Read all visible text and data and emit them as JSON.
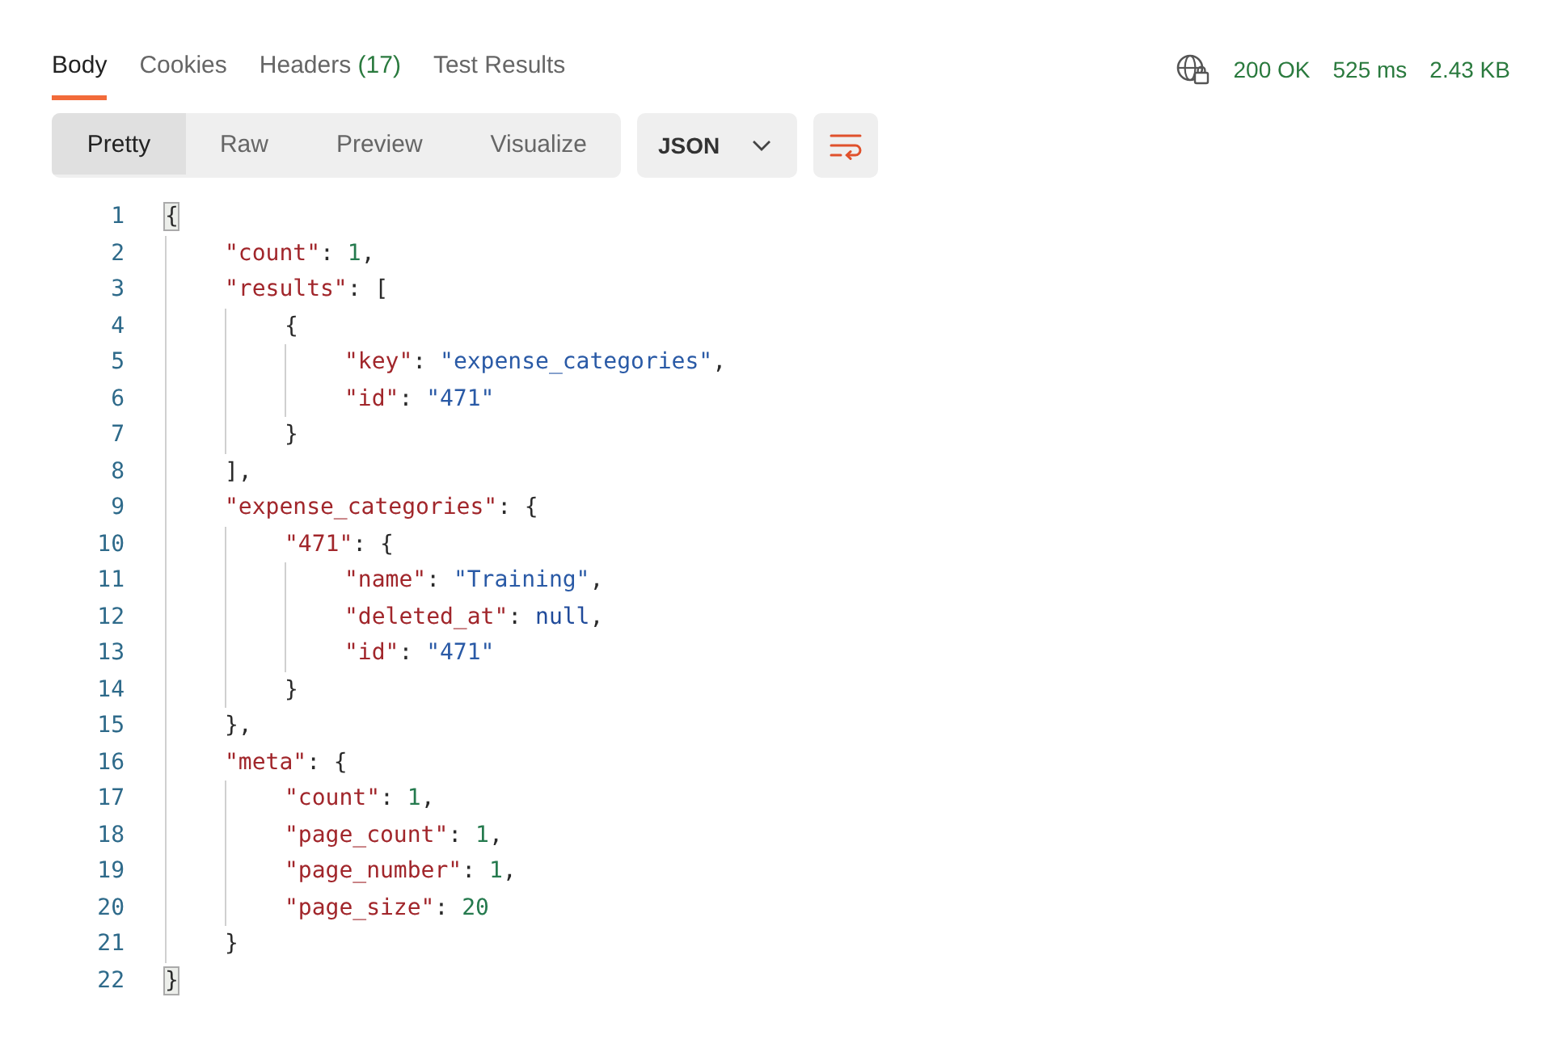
{
  "tabs": [
    {
      "label": "Body",
      "selected": true
    },
    {
      "label": "Cookies",
      "selected": false
    },
    {
      "label": "Headers",
      "count": "(17)",
      "selected": false
    },
    {
      "label": "Test Results",
      "selected": false
    }
  ],
  "status": {
    "code": "200 OK",
    "time": "525 ms",
    "size": "2.43 KB"
  },
  "view_modes": [
    {
      "label": "Pretty",
      "selected": true
    },
    {
      "label": "Raw",
      "selected": false
    },
    {
      "label": "Preview",
      "selected": false
    },
    {
      "label": "Visualize",
      "selected": false
    }
  ],
  "format_dropdown": {
    "value": "JSON"
  },
  "code": [
    {
      "number": "1",
      "bracket_highlight": true,
      "tokens": [
        {
          "kind": "punct",
          "text": "{"
        }
      ],
      "children": [
        {
          "number": "2",
          "bracket_highlight": false,
          "tokens": [
            {
              "kind": "key",
              "text": "\"count\""
            },
            {
              "kind": "punct",
              "text": ": "
            },
            {
              "kind": "number",
              "text": "1"
            },
            {
              "kind": "punct",
              "text": ","
            }
          ]
        },
        {
          "number": "3",
          "bracket_highlight": false,
          "tokens": [
            {
              "kind": "key",
              "text": "\"results\""
            },
            {
              "kind": "punct",
              "text": ": ["
            }
          ],
          "children": [
            {
              "number": "4",
              "bracket_highlight": false,
              "tokens": [
                {
                  "kind": "punct",
                  "text": "{"
                }
              ],
              "children": [
                {
                  "number": "5",
                  "bracket_highlight": false,
                  "tokens": [
                    {
                      "kind": "key",
                      "text": "\"key\""
                    },
                    {
                      "kind": "punct",
                      "text": ": "
                    },
                    {
                      "kind": "string",
                      "text": "\"expense_categories\""
                    },
                    {
                      "kind": "punct",
                      "text": ","
                    }
                  ]
                },
                {
                  "number": "6",
                  "bracket_highlight": false,
                  "tokens": [
                    {
                      "kind": "key",
                      "text": "\"id\""
                    },
                    {
                      "kind": "punct",
                      "text": ": "
                    },
                    {
                      "kind": "string",
                      "text": "\"471\""
                    }
                  ]
                }
              ]
            },
            {
              "number": "7",
              "bracket_highlight": false,
              "tokens": [
                {
                  "kind": "punct",
                  "text": "}"
                }
              ]
            }
          ]
        },
        {
          "number": "8",
          "bracket_highlight": false,
          "tokens": [
            {
              "kind": "punct",
              "text": "],"
            }
          ]
        },
        {
          "number": "9",
          "bracket_highlight": false,
          "tokens": [
            {
              "kind": "key",
              "text": "\"expense_categories\""
            },
            {
              "kind": "punct",
              "text": ": {"
            }
          ],
          "children": [
            {
              "number": "10",
              "bracket_highlight": false,
              "tokens": [
                {
                  "kind": "key",
                  "text": "\"471\""
                },
                {
                  "kind": "punct",
                  "text": ": {"
                }
              ],
              "children": [
                {
                  "number": "11",
                  "bracket_highlight": false,
                  "tokens": [
                    {
                      "kind": "key",
                      "text": "\"name\""
                    },
                    {
                      "kind": "punct",
                      "text": ": "
                    },
                    {
                      "kind": "string",
                      "text": "\"Training\""
                    },
                    {
                      "kind": "punct",
                      "text": ","
                    }
                  ]
                },
                {
                  "number": "12",
                  "bracket_highlight": false,
                  "tokens": [
                    {
                      "kind": "key",
                      "text": "\"deleted_at\""
                    },
                    {
                      "kind": "punct",
                      "text": ": "
                    },
                    {
                      "kind": "null",
                      "text": "null"
                    },
                    {
                      "kind": "punct",
                      "text": ","
                    }
                  ]
                },
                {
                  "number": "13",
                  "bracket_highlight": false,
                  "tokens": [
                    {
                      "kind": "key",
                      "text": "\"id\""
                    },
                    {
                      "kind": "punct",
                      "text": ": "
                    },
                    {
                      "kind": "string",
                      "text": "\"471\""
                    }
                  ]
                }
              ]
            },
            {
              "number": "14",
              "bracket_highlight": false,
              "tokens": [
                {
                  "kind": "punct",
                  "text": "}"
                }
              ]
            }
          ]
        },
        {
          "number": "15",
          "bracket_highlight": false,
          "tokens": [
            {
              "kind": "punct",
              "text": "},"
            }
          ]
        },
        {
          "number": "16",
          "bracket_highlight": false,
          "tokens": [
            {
              "kind": "key",
              "text": "\"meta\""
            },
            {
              "kind": "punct",
              "text": ": {"
            }
          ],
          "children": [
            {
              "number": "17",
              "bracket_highlight": false,
              "tokens": [
                {
                  "kind": "key",
                  "text": "\"count\""
                },
                {
                  "kind": "punct",
                  "text": ": "
                },
                {
                  "kind": "number",
                  "text": "1"
                },
                {
                  "kind": "punct",
                  "text": ","
                }
              ]
            },
            {
              "number": "18",
              "bracket_highlight": false,
              "tokens": [
                {
                  "kind": "key",
                  "text": "\"page_count\""
                },
                {
                  "kind": "punct",
                  "text": ": "
                },
                {
                  "kind": "number",
                  "text": "1"
                },
                {
                  "kind": "punct",
                  "text": ","
                }
              ]
            },
            {
              "number": "19",
              "bracket_highlight": false,
              "tokens": [
                {
                  "kind": "key",
                  "text": "\"page_number\""
                },
                {
                  "kind": "punct",
                  "text": ": "
                },
                {
                  "kind": "number",
                  "text": "1"
                },
                {
                  "kind": "punct",
                  "text": ","
                }
              ]
            },
            {
              "number": "20",
              "bracket_highlight": false,
              "tokens": [
                {
                  "kind": "key",
                  "text": "\"page_size\""
                },
                {
                  "kind": "punct",
                  "text": ": "
                },
                {
                  "kind": "number",
                  "text": "20"
                }
              ]
            }
          ]
        },
        {
          "number": "21",
          "bracket_highlight": false,
          "tokens": [
            {
              "kind": "punct",
              "text": "}"
            }
          ]
        }
      ]
    },
    {
      "number": "22",
      "bracket_highlight": true,
      "tokens": [
        {
          "kind": "punct",
          "text": "}"
        }
      ]
    }
  ]
}
